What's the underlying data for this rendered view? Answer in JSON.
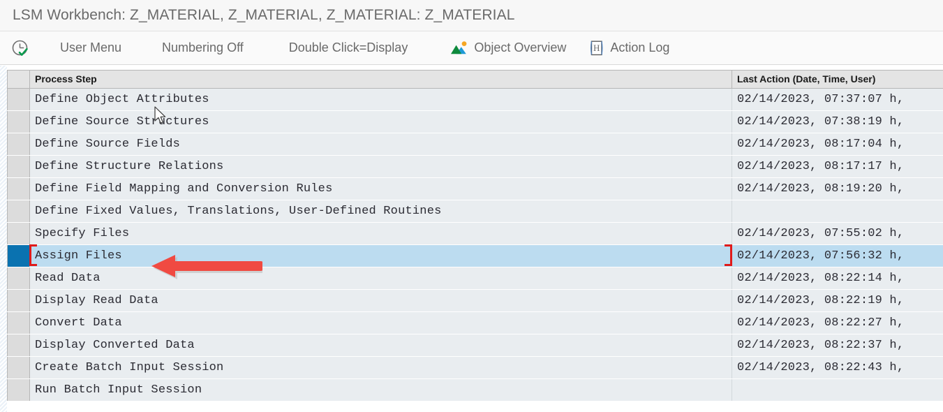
{
  "window": {
    "title": "LSM Workbench: Z_MATERIAL, Z_MATERIAL, Z_MATERIAL: Z_MATERIAL"
  },
  "toolbar": {
    "items": [
      {
        "icon": "clock-check-icon",
        "label": ""
      },
      {
        "icon": "",
        "label": "User Menu"
      },
      {
        "icon": "",
        "label": "Numbering Off"
      },
      {
        "icon": "",
        "label": "Double Click=Display"
      },
      {
        "icon": "image-mountains-icon",
        "label": "Object Overview"
      },
      {
        "icon": "document-h-icon",
        "label": "Action Log"
      }
    ]
  },
  "table": {
    "columns": {
      "selector": "",
      "process_step": "Process Step",
      "last_action": "Last Action (Date, Time, User)"
    },
    "rows": [
      {
        "step": "Define Object Attributes",
        "last_action": "02/14/2023, 07:37:07 h,"
      },
      {
        "step": "Define Source Structures",
        "last_action": "02/14/2023, 07:38:19 h,"
      },
      {
        "step": "Define Source Fields",
        "last_action": "02/14/2023, 08:17:04 h,"
      },
      {
        "step": "Define Structure Relations",
        "last_action": "02/14/2023, 08:17:17 h,"
      },
      {
        "step": "Define Field Mapping and Conversion Rules",
        "last_action": "02/14/2023, 08:19:20 h,"
      },
      {
        "step": "Define Fixed Values, Translations, User-Defined Routines",
        "last_action": ""
      },
      {
        "step": "Specify Files",
        "last_action": "02/14/2023, 07:55:02 h,"
      },
      {
        "step": "Assign Files",
        "last_action": "02/14/2023, 07:56:32 h,"
      },
      {
        "step": "Read Data",
        "last_action": "02/14/2023, 08:22:14 h,"
      },
      {
        "step": "Display Read Data",
        "last_action": "02/14/2023, 08:22:19 h,"
      },
      {
        "step": "Convert Data",
        "last_action": "02/14/2023, 08:22:27 h,"
      },
      {
        "step": "Display Converted Data",
        "last_action": "02/14/2023, 08:22:37 h,"
      },
      {
        "step": "Create Batch Input Session",
        "last_action": "02/14/2023, 08:22:43 h,"
      },
      {
        "step": "Run Batch Input Session",
        "last_action": ""
      }
    ],
    "selected_row_index": 7
  },
  "annotation": {
    "arrow_color": "#f04a42",
    "direction": "left",
    "points_at": "Assign Files"
  },
  "colors": {
    "row_background": "#e9edf0",
    "selected_row": "#bcdcf0",
    "selector_selected": "#0a72b0",
    "header_background": "#e4e4e4",
    "focus_bracket": "#e01b1b",
    "title_text": "#6a6a6a"
  }
}
